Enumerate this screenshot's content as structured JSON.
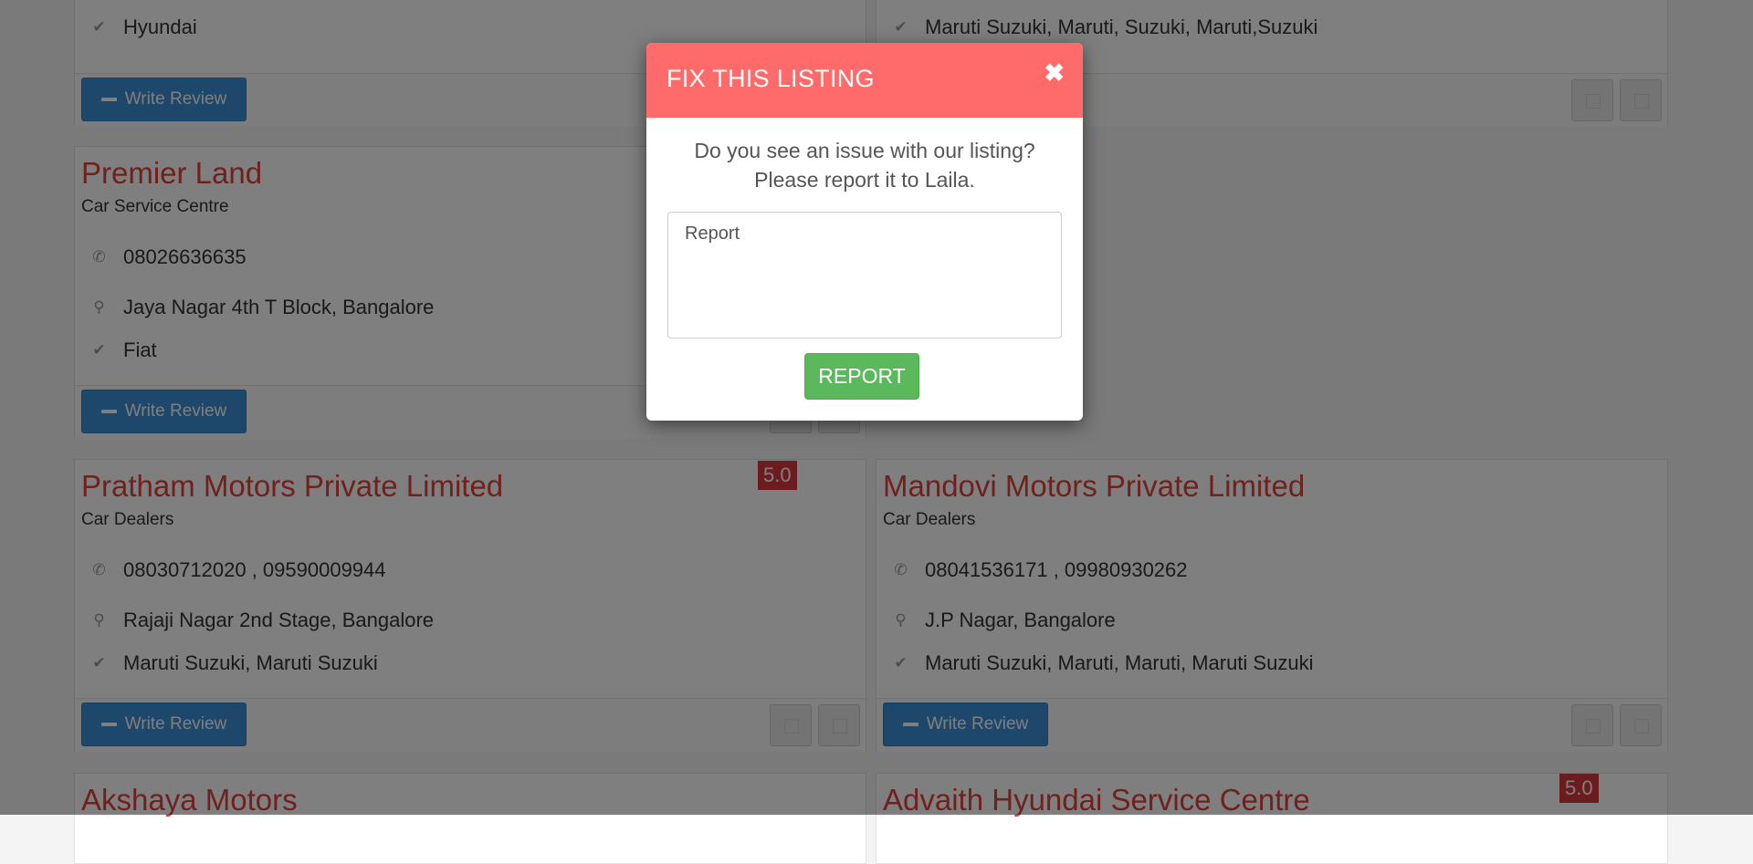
{
  "colors": {
    "title": "#e0433d",
    "write_button": "#3b8fd6",
    "rating_badge": "#d9363e",
    "modal_header": "#ff6a6a",
    "report_button": "#5cb85c"
  },
  "listings": [
    {
      "title": "",
      "category": "",
      "phone": "",
      "address": "",
      "brands": "Hyundai",
      "write_review_label": "Write Review"
    },
    {
      "title": "",
      "category": "",
      "phone": "",
      "address": "",
      "brands": "Maruti Suzuki, Maruti, Suzuki, Maruti,Suzuki"
    },
    {
      "title": "Premier Land",
      "category": "Car Service Centre",
      "phone": "08026636635",
      "address": "Jaya Nagar 4th T Block, Bangalore",
      "brands": "Fiat",
      "write_review_label": "Write Review"
    },
    {
      "title": "Pratham Motors Private Limited",
      "category": "Car Dealers",
      "phone": "08030712020 , 09590009944",
      "address": "Rajaji Nagar 2nd Stage, Bangalore",
      "brands": "Maruti Suzuki, Maruti Suzuki",
      "rating": "5.0",
      "write_review_label": "Write Review"
    },
    {
      "title": "Mandovi Motors Private Limited",
      "category": "Car Dealers",
      "phone": "08041536171 , 09980930262",
      "address": "J.P Nagar, Bangalore",
      "brands": "Maruti Suzuki, Maruti, Maruti, Maruti Suzuki",
      "write_review_label": "Write Review"
    },
    {
      "title": "Akshaya Motors"
    },
    {
      "title": "Advaith Hyundai Service Centre",
      "rating": "5.0"
    }
  ],
  "modal": {
    "title": "FIX THIS LISTING",
    "close_glyph": "✖",
    "line1": "Do you see an issue with our listing?",
    "line2": "Please report it to Laila.",
    "report_placeholder": "Report",
    "report_button": "REPORT"
  },
  "icons": {
    "phone": "phone-icon",
    "location": "map-pin-icon",
    "check": "check-icon",
    "pencil": "pencil-icon",
    "close": "close-icon"
  }
}
